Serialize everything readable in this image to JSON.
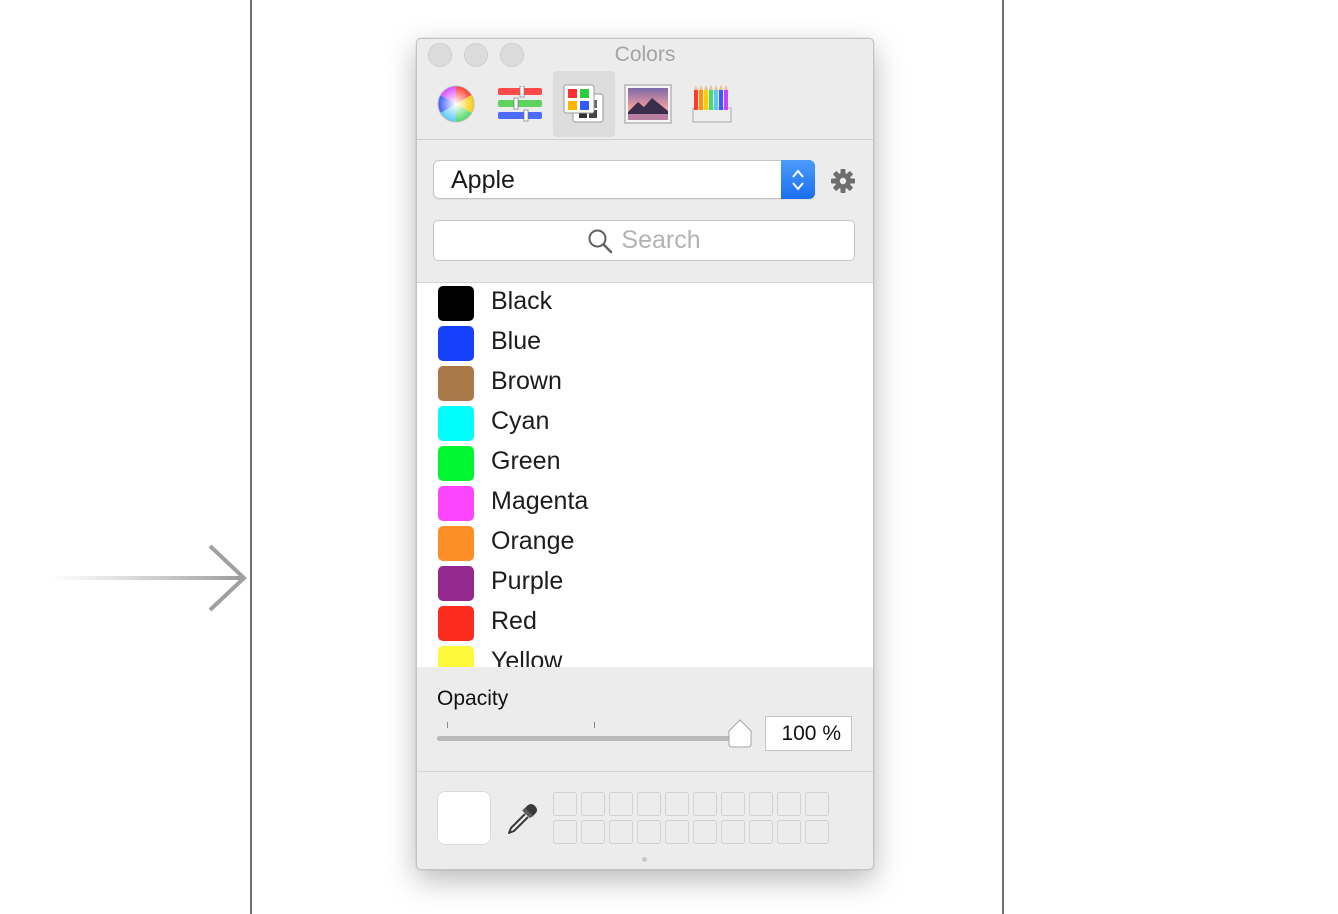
{
  "window": {
    "title": "Colors",
    "buttons": [
      "close",
      "minimize",
      "zoom"
    ]
  },
  "toolbar": {
    "tools": [
      {
        "name": "color-wheel-icon",
        "selected": false
      },
      {
        "name": "color-sliders-icon",
        "selected": false
      },
      {
        "name": "color-palettes-icon",
        "selected": true
      },
      {
        "name": "image-palettes-icon",
        "selected": false
      },
      {
        "name": "pencils-icon",
        "selected": false
      }
    ]
  },
  "palette": {
    "selected": "Apple",
    "accent": "#1a6ff1"
  },
  "search": {
    "placeholder": "Search"
  },
  "colors": [
    {
      "label": "Black",
      "hex": "#000000"
    },
    {
      "label": "Blue",
      "hex": "#1740fb"
    },
    {
      "label": "Brown",
      "hex": "#a87847"
    },
    {
      "label": "Cyan",
      "hex": "#00fcfd"
    },
    {
      "label": "Green",
      "hex": "#00f732"
    },
    {
      "label": "Magenta",
      "hex": "#fc45fc"
    },
    {
      "label": "Orange",
      "hex": "#fd8f26"
    },
    {
      "label": "Purple",
      "hex": "#93298f"
    },
    {
      "label": "Red",
      "hex": "#fb2b1e"
    },
    {
      "label": "Yellow",
      "hex": "#fdf83a"
    }
  ],
  "opacity": {
    "label": "Opacity",
    "value_text": "100 %",
    "value": 100
  },
  "current_color": "#ffffff"
}
